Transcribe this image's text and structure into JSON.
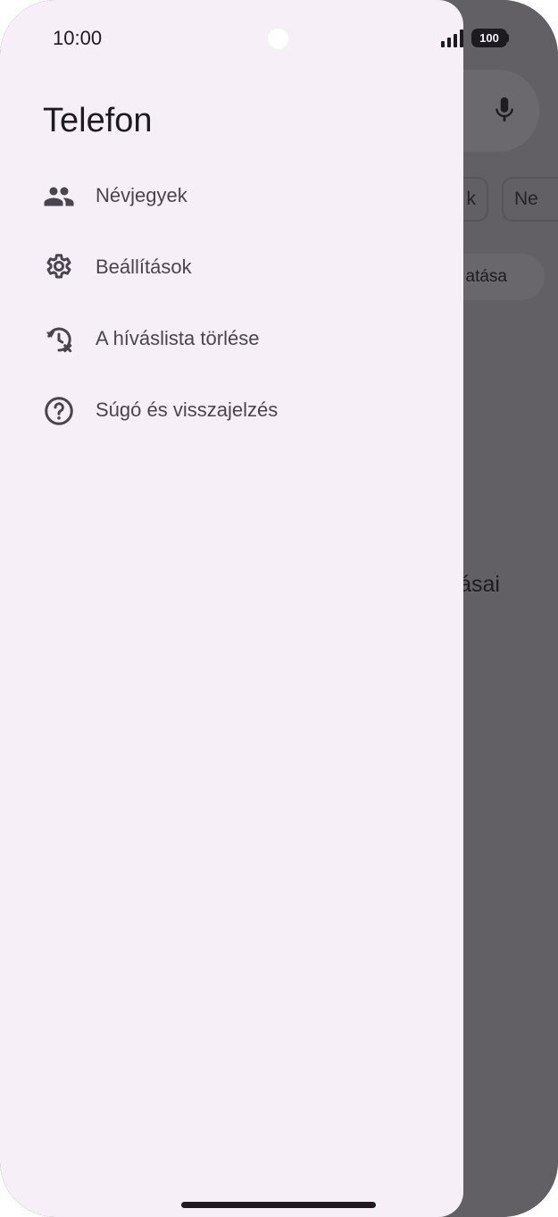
{
  "status_bar": {
    "time": "10:00",
    "battery": "100"
  },
  "background_app": {
    "chip_1_text": "k",
    "chip_2_text": "Ne",
    "pill_text": "atása",
    "partial_text": "ásai"
  },
  "drawer": {
    "title": "Telefon",
    "items": [
      {
        "label": "Névjegyek",
        "icon": "contacts-icon"
      },
      {
        "label": "Beállítások",
        "icon": "settings-icon"
      },
      {
        "label": "A híváslista törlése",
        "icon": "clear-call-history-icon"
      },
      {
        "label": "Súgó és visszajelzés",
        "icon": "help-icon"
      }
    ]
  },
  "colors": {
    "drawer_background": "#f6eff7",
    "scrim": "#626065",
    "text_primary": "#1d1b20",
    "text_secondary": "#49454f"
  }
}
